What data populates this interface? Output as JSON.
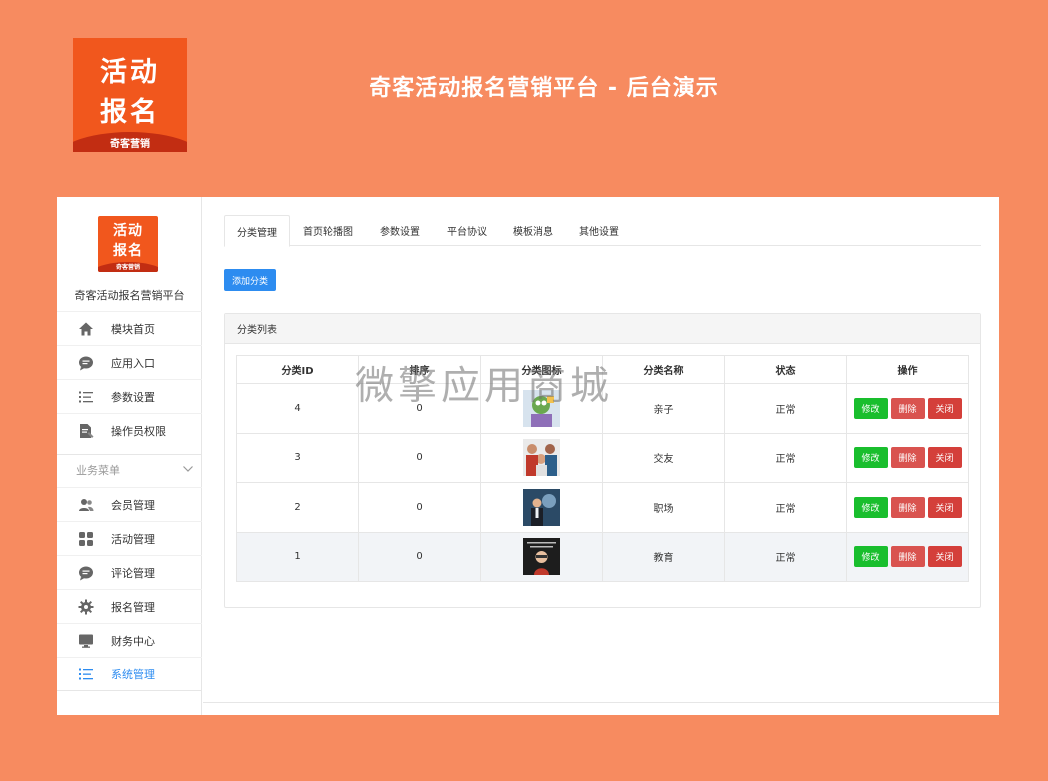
{
  "banner": {
    "logo_line1": "活动",
    "logo_line2": "报名",
    "logo_tag": "奇客营销",
    "headline": "奇客活动报名营销平台 - 后台演示"
  },
  "sidebar": {
    "logo_line1": "活动",
    "logo_line2": "报名",
    "logo_tag": "奇客营销",
    "brand_name": "奇客活动报名营销平台",
    "top_items": [
      {
        "label": "模块首页",
        "icon": "home-icon"
      },
      {
        "label": "应用入口",
        "icon": "chat-icon"
      },
      {
        "label": "参数设置",
        "icon": "list-icon"
      },
      {
        "label": "操作员权限",
        "icon": "document-edit-icon"
      }
    ],
    "section_label": "业务菜单",
    "section_items": [
      {
        "label": "会员管理",
        "icon": "users-icon"
      },
      {
        "label": "活动管理",
        "icon": "grid-icon"
      },
      {
        "label": "评论管理",
        "icon": "comment-icon"
      },
      {
        "label": "报名管理",
        "icon": "gear-icon"
      },
      {
        "label": "财务中心",
        "icon": "monitor-icon"
      },
      {
        "label": "系统管理",
        "icon": "list-icon",
        "active": true
      }
    ],
    "active_color": "#2d8cf0"
  },
  "tabs": [
    "分类管理",
    "首页轮播图",
    "参数设置",
    "平台协议",
    "模板消息",
    "其他设置"
  ],
  "active_tab": "分类管理",
  "add_button": "添加分类",
  "panel_title": "分类列表",
  "table": {
    "headers": [
      "分类ID",
      "排序",
      "分类图标",
      "分类名称",
      "状态",
      "操作"
    ],
    "rows": [
      {
        "id": "4",
        "sort": "0",
        "name": "亲子",
        "status": "正常"
      },
      {
        "id": "3",
        "sort": "0",
        "name": "交友",
        "status": "正常"
      },
      {
        "id": "2",
        "sort": "0",
        "name": "职场",
        "status": "正常"
      },
      {
        "id": "1",
        "sort": "0",
        "name": "教育",
        "status": "正常"
      }
    ],
    "ops": {
      "edit": "修改",
      "delete": "删除",
      "close": "关闭"
    }
  },
  "watermark": "微擎应用商城",
  "colors": {
    "background": "#f78b60",
    "brand": "#f1571d",
    "primary": "#2d8cf0",
    "edit": "#19be2d",
    "delete": "#d9534f"
  }
}
